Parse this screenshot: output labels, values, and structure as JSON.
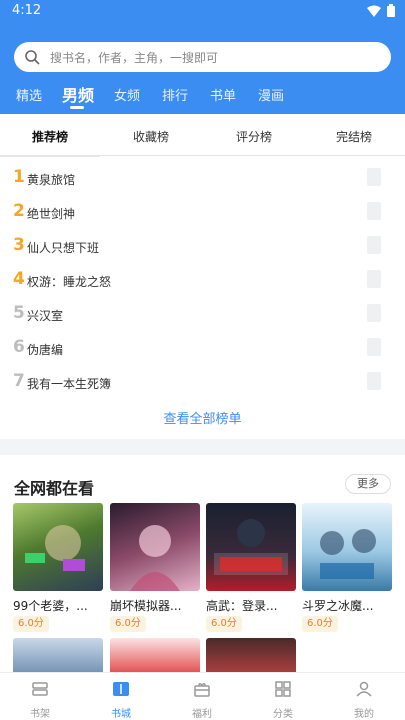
{
  "status_bar": {
    "time": "4:12"
  },
  "search": {
    "placeholder": "搜书名，作者，主角，一搜即可"
  },
  "channel_tabs": [
    "精选",
    "男频",
    "女频",
    "排行",
    "书单",
    "漫画"
  ],
  "active_channel": "男频",
  "rank_tabs": [
    "推荐榜",
    "收藏榜",
    "评分榜",
    "完结榜"
  ],
  "active_rank_tab": "推荐榜",
  "rank_list": [
    {
      "num": "1",
      "title": "黄泉旅馆"
    },
    {
      "num": "2",
      "title": "绝世剑神"
    },
    {
      "num": "3",
      "title": "仙人只想下班"
    },
    {
      "num": "4",
      "title": "权游：睡龙之怒"
    },
    {
      "num": "5",
      "title": "兴汉室"
    },
    {
      "num": "6",
      "title": "伪唐编"
    },
    {
      "num": "7",
      "title": "我有一本生死簿"
    }
  ],
  "view_all": "查看全部榜单",
  "section": {
    "title": "全网都在看",
    "more": "更多"
  },
  "books": [
    {
      "title": "99个老婆，...",
      "score": "6.0分",
      "cover_color": "#6b8a3a"
    },
    {
      "title": "崩坏模拟器...",
      "score": "6.0分",
      "cover_color": "#6a3b52"
    },
    {
      "title": "高武：登录...",
      "score": "6.0分",
      "cover_color": "#1f2a3a"
    },
    {
      "title": "斗罗之冰魔...",
      "score": "6.0分",
      "cover_color": "#7dbad8"
    }
  ],
  "bottom_nav": [
    {
      "label": "书架",
      "icon": "bookshelf-icon"
    },
    {
      "label": "书城",
      "icon": "bookstore-icon"
    },
    {
      "label": "福利",
      "icon": "gift-icon"
    },
    {
      "label": "分类",
      "icon": "category-icon"
    },
    {
      "label": "我的",
      "icon": "profile-icon"
    }
  ],
  "active_nav": "书城",
  "colors": {
    "accent": "#3c8df2",
    "rank_top": "#f5a623",
    "score_text": "#d58b1b"
  }
}
